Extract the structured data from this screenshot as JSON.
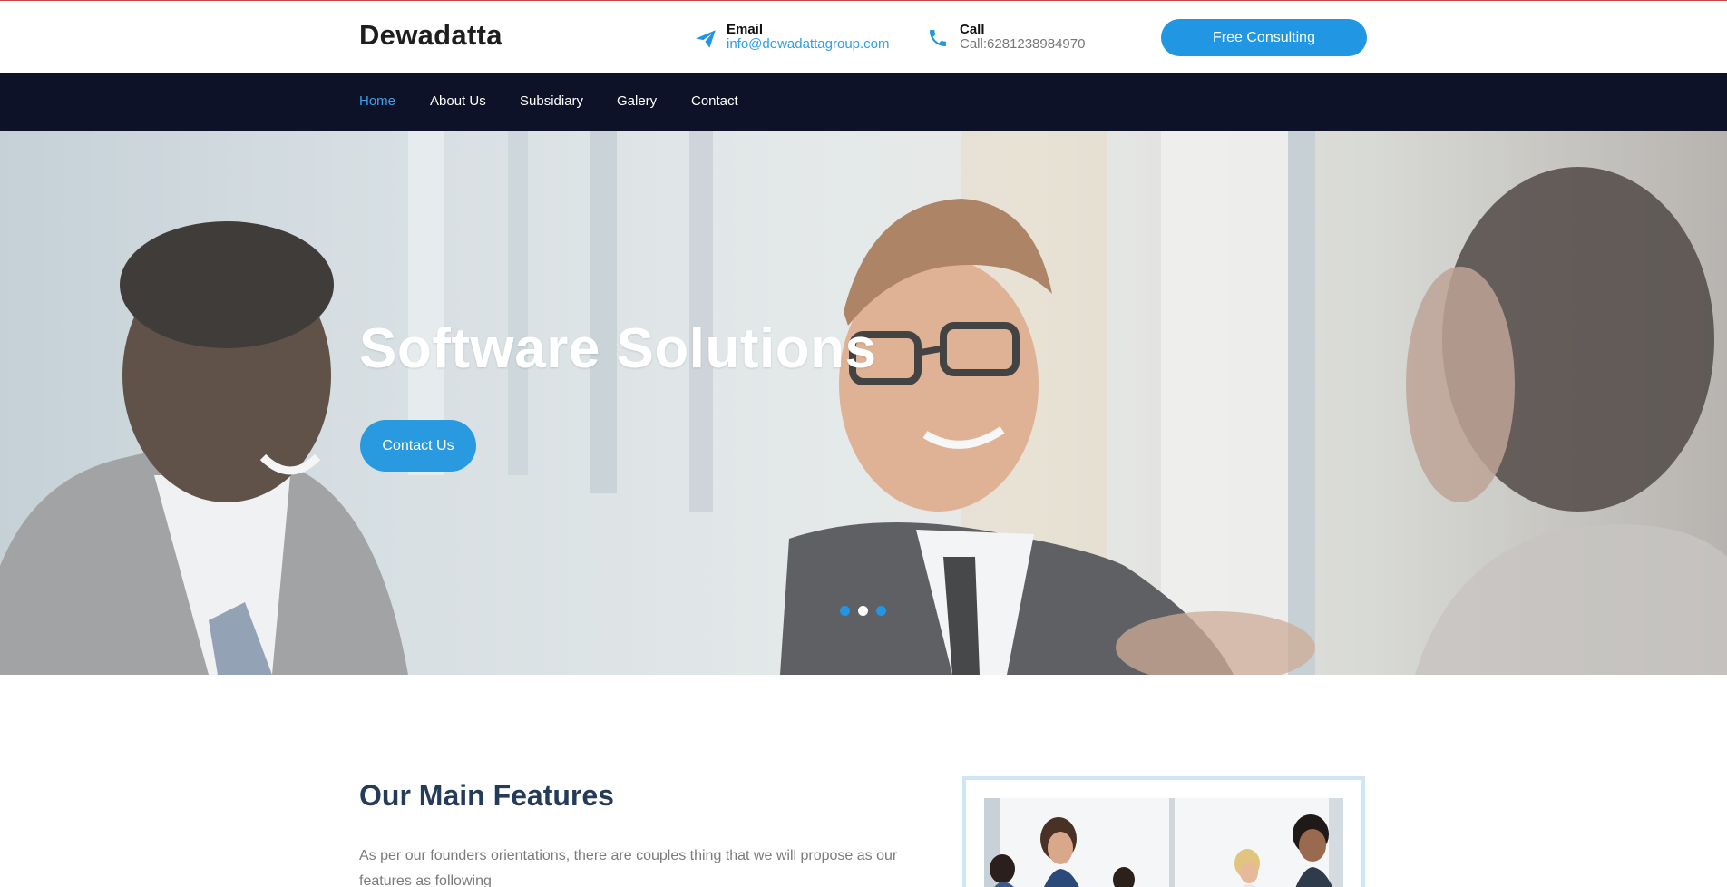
{
  "header": {
    "logo": "Dewadatta",
    "email": {
      "title": "Email",
      "value": "info@dewadattagroup.com",
      "icon": "paper-plane-icon"
    },
    "call": {
      "title": "Call",
      "value": "Call:6281238984970",
      "icon": "phone-icon"
    },
    "cta_label": "Free Consulting"
  },
  "nav": {
    "items": [
      {
        "label": "Home",
        "active": true
      },
      {
        "label": "About Us"
      },
      {
        "label": "Subsidiary"
      },
      {
        "label": "Galery"
      },
      {
        "label": "Contact"
      }
    ]
  },
  "hero": {
    "title": "Software Solutions",
    "cta_label": "Contact Us",
    "slider": {
      "total": 3,
      "active_index": 1
    }
  },
  "features": {
    "title": "Our Main Features",
    "text": "As per our founders orientations, there are couples thing that we will propose as our features as following"
  },
  "colors": {
    "accent": "#2196e3",
    "nav_bg": "#0e1229",
    "heading": "#243b59"
  }
}
